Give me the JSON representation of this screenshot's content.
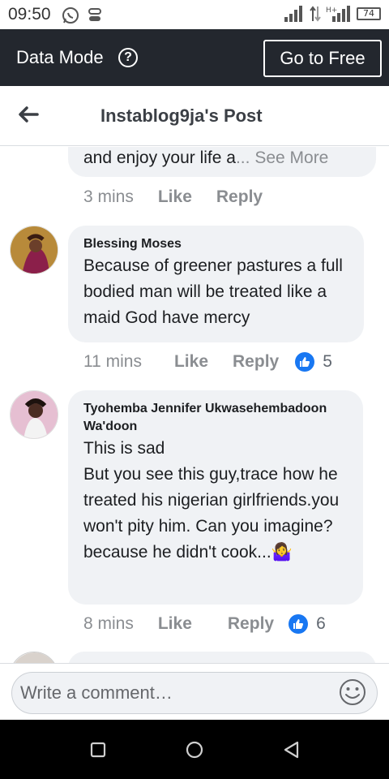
{
  "status_bar": {
    "time": "09:50",
    "battery": "74",
    "icons": [
      "whatsapp-icon",
      "data-saver-icon",
      "signal-icon",
      "network-hplus-icon"
    ]
  },
  "data_mode": {
    "label": "Data Mode",
    "info_icon": "info-icon",
    "go_free_label": "Go to Free"
  },
  "header": {
    "title": "Instablog9ja's Post",
    "back_icon": "back-arrow-icon"
  },
  "comments": [
    {
      "text": "and enjoy your life a",
      "ellipsis": "...",
      "see_more": " See More",
      "time": "3 mins",
      "like_label": "Like",
      "reply_label": "Reply"
    },
    {
      "author": "Blessing Moses",
      "text": "Because of greener pastures a full bodied man will be treated like a maid God have mercy",
      "time": "11 mins",
      "like_label": "Like",
      "reply_label": "Reply",
      "reactions": "5"
    },
    {
      "author": "Tyohemba Jennifer Ukwasehembadoon Wa'doon",
      "text": "This is sad\nBut you see this guy,trace how he treated his nigerian girlfriends.you won't pity him. Can you imagine? because he didn't cook...",
      "emoji": "🤷‍♀️",
      "time": "8 mins",
      "like_label": "Like",
      "reply_label": "Reply",
      "reactions": "6"
    }
  ],
  "composer": {
    "placeholder": "Write a comment…",
    "emoji_icon": "smiley-icon"
  },
  "nav": [
    "recents-square-icon",
    "home-circle-icon",
    "back-triangle-icon"
  ],
  "colors": {
    "data_bar": "#23272e",
    "bubble": "#f0f2f5",
    "like_blue": "#1877f2",
    "meta_gray": "#8a8d91"
  }
}
